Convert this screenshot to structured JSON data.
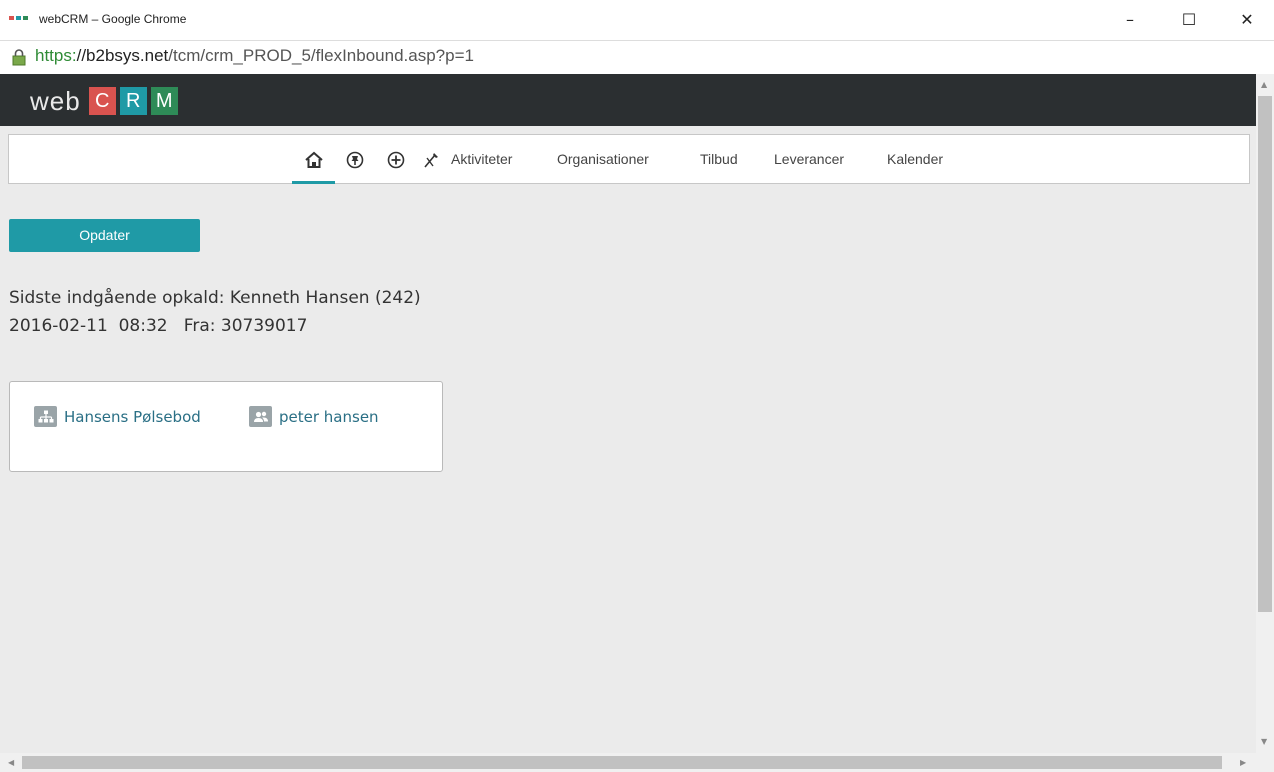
{
  "window": {
    "title": "webCRM – Google Chrome",
    "minimize_icon": "minimize-icon",
    "maximize_icon": "maximize-icon",
    "close_icon": "close-icon"
  },
  "address_bar": {
    "scheme": "https:",
    "host": "//b2bsys.net",
    "path": "/tcm/crm_PROD_5/flexInbound.asp?p=1"
  },
  "brand": {
    "web": "web",
    "letters": [
      "C",
      "R",
      "M"
    ],
    "colors": [
      "#d9534f",
      "#1f9aa6",
      "#2e8b57"
    ]
  },
  "nav": {
    "icons": [
      "home-icon",
      "pin-icon",
      "add-icon",
      "tools-icon"
    ],
    "items": [
      "Aktiviteter",
      "Organisationer",
      "Tilbud",
      "Leverancer",
      "Kalender"
    ]
  },
  "refresh_button": {
    "label": "Opdater"
  },
  "last_call": {
    "line1": "Sidste indgående opkald: Kenneth Hansen (242)",
    "line2": "2016-02-11  08:32   Fra: 30739017"
  },
  "card": {
    "links": [
      {
        "icon": "organization-icon",
        "label": "Hansens Pølsebod"
      },
      {
        "icon": "persons-icon",
        "label": "peter hansen"
      }
    ]
  },
  "accent_color": "#1f9aa6"
}
